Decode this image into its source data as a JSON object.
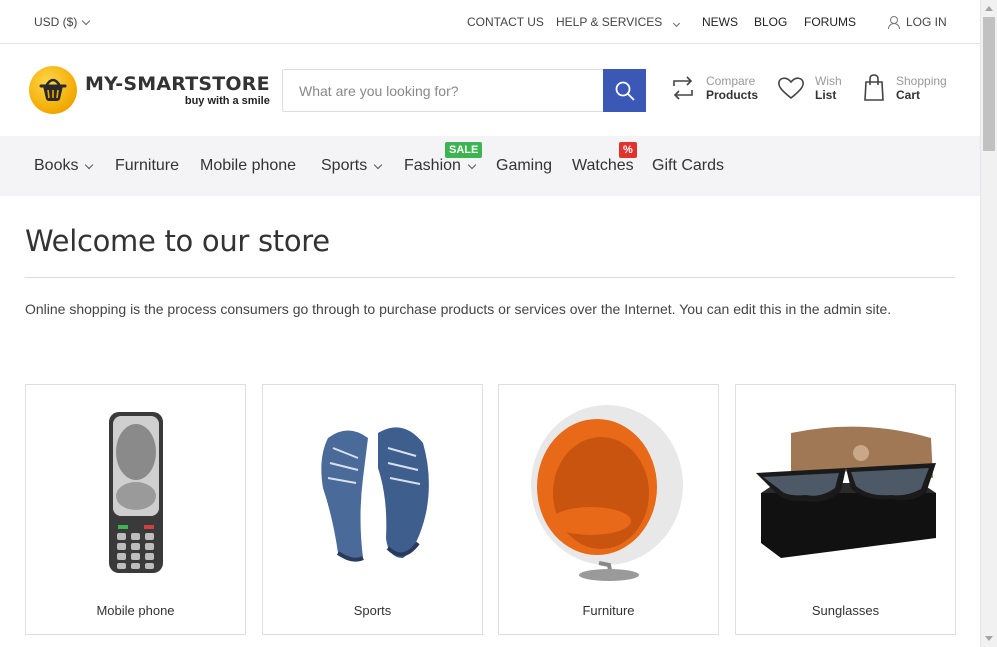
{
  "topbar": {
    "currency": "USD  ($)",
    "links": [
      {
        "label": "CONTACT US"
      },
      {
        "label": "HELP & SERVICES"
      },
      {
        "label": "NEWS"
      },
      {
        "label": "BLOG"
      },
      {
        "label": "FORUMS"
      },
      {
        "label": "LOG IN"
      }
    ]
  },
  "header": {
    "logo_main": "MY-SMARTSTORE",
    "logo_sub": "buy with a smile",
    "search_placeholder": "What are you looking for?",
    "actions": [
      {
        "line1": "Compare",
        "line2": "Products",
        "icon": "compare-icon"
      },
      {
        "line1": "Wish",
        "line2": "List",
        "icon": "heart-icon"
      },
      {
        "line1": "Shopping",
        "line2": "Cart",
        "icon": "shopping-bag-icon"
      }
    ]
  },
  "nav": {
    "items": [
      {
        "label": "Books"
      },
      {
        "label": "Furniture"
      },
      {
        "label": "Mobile phone"
      },
      {
        "label": "Sports"
      },
      {
        "label": "Fashion",
        "badge": "SALE"
      },
      {
        "label": "Gaming"
      },
      {
        "label": "Watches",
        "badge": "%"
      },
      {
        "label": "Gift Cards"
      }
    ]
  },
  "main": {
    "title": "Welcome to our store",
    "intro": "Online shopping is the process consumers go through to purchase products or services over the Internet. You can edit this in the admin site.",
    "categories": [
      {
        "label": "Mobile phone"
      },
      {
        "label": "Sports"
      },
      {
        "label": "Furniture"
      },
      {
        "label": "Sunglasses"
      }
    ]
  },
  "colors": {
    "accent": "#3b58b7",
    "sale": "#3cb550",
    "percent": "#e0332e",
    "nav_bg": "#f4f4f6"
  }
}
